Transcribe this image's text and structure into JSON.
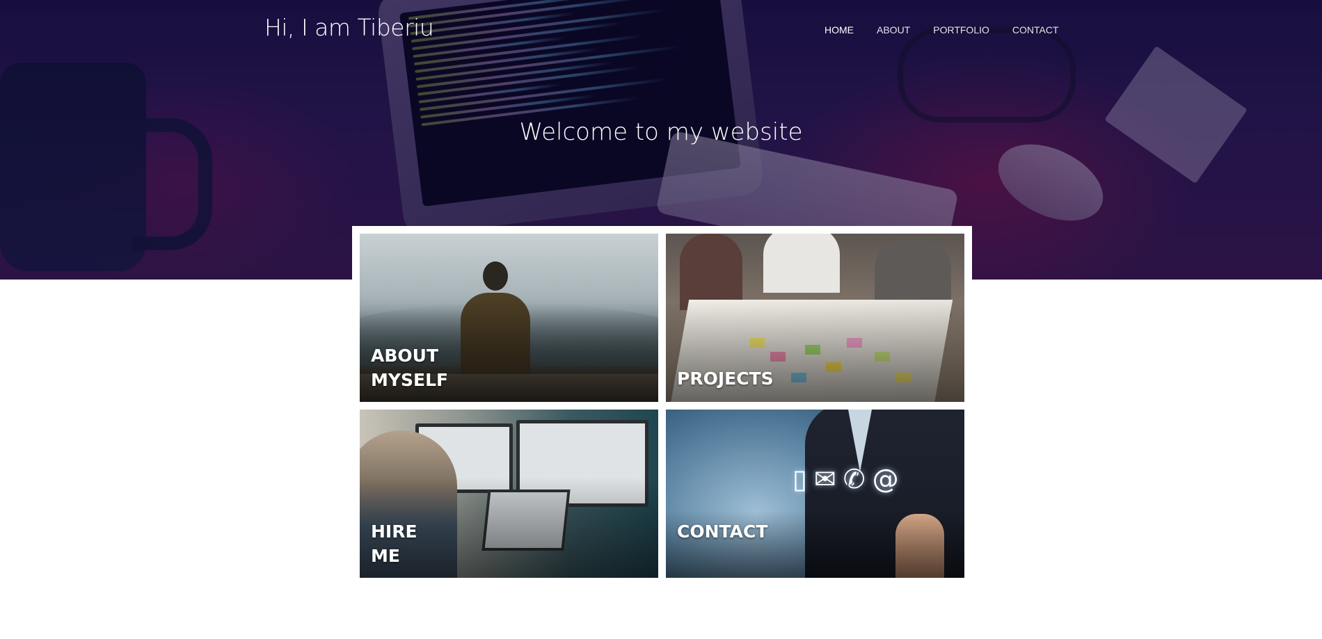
{
  "header": {
    "site_title": "Hi, I am Tiberiu",
    "nav": [
      {
        "label": "HOME",
        "active": true
      },
      {
        "label": "ABOUT",
        "active": false
      },
      {
        "label": "PORTFOLIO",
        "active": false
      },
      {
        "label": "CONTACT",
        "active": false
      }
    ]
  },
  "hero": {
    "welcome": "Welcome to my website"
  },
  "tiles": {
    "about": {
      "line1": "ABOUT",
      "line2": "MYSELF"
    },
    "projects": {
      "line1": "PROJECTS"
    },
    "hire": {
      "line1": "HIRE",
      "line2": "ME"
    },
    "contact": {
      "line1": "CONTACT",
      "icons": [
        "phone-icon",
        "envelope-icon",
        "telephone-icon",
        "at-sign-icon"
      ]
    }
  },
  "colors": {
    "hero_overlay": "#2a1a4e",
    "text_white": "#ffffff",
    "page_background": "#ffffff"
  }
}
